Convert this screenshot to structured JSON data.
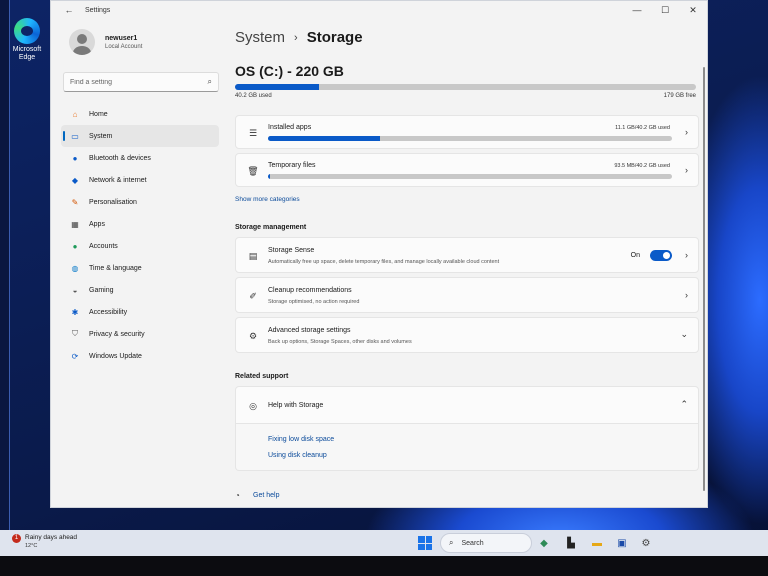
{
  "window": {
    "title": "Settings",
    "controls": {
      "minimize": "—",
      "maximize": "☐",
      "close": "✕"
    }
  },
  "desktop": {
    "edge_label": "Microsoft Edge"
  },
  "profile": {
    "name": "newuser1",
    "account_type": "Local Account"
  },
  "search": {
    "placeholder": "Find a setting"
  },
  "nav": [
    {
      "label": "Home",
      "icon": "home-icon",
      "color": "#e8792b",
      "active": false
    },
    {
      "label": "System",
      "icon": "system-icon",
      "color": "#0a5ac8",
      "active": true
    },
    {
      "label": "Bluetooth & devices",
      "icon": "bluetooth-icon",
      "color": "#0a5ac8",
      "active": false
    },
    {
      "label": "Network & internet",
      "icon": "wifi-icon",
      "color": "#0a5ac8",
      "active": false
    },
    {
      "label": "Personalisation",
      "icon": "brush-icon",
      "color": "#d35400",
      "active": false
    },
    {
      "label": "Apps",
      "icon": "apps-icon",
      "color": "#444444",
      "active": false
    },
    {
      "label": "Accounts",
      "icon": "person-icon",
      "color": "#1e9a5a",
      "active": false
    },
    {
      "label": "Time & language",
      "icon": "globe-clock-icon",
      "color": "#0a7ac8",
      "active": false
    },
    {
      "label": "Gaming",
      "icon": "gamepad-icon",
      "color": "#555555",
      "active": false
    },
    {
      "label": "Accessibility",
      "icon": "accessibility-icon",
      "color": "#0a5ac8",
      "active": false
    },
    {
      "label": "Privacy & security",
      "icon": "shield-icon",
      "color": "#555555",
      "active": false
    },
    {
      "label": "Windows Update",
      "icon": "update-icon",
      "color": "#0a5ac8",
      "active": false
    }
  ],
  "breadcrumb": {
    "parent": "System",
    "separator": "›",
    "current": "Storage"
  },
  "drive": {
    "title": "OS (C:) - 220 GB",
    "used_label": "40.2 GB used",
    "free_label": "179 GB free",
    "used_fraction": 0.183
  },
  "categories": [
    {
      "title": "Installed apps",
      "value": "11.1 GB/40.2 GB used",
      "fraction": 0.276,
      "icon": "list-icon"
    },
    {
      "title": "Temporary files",
      "value": "93.5 MB/40.2 GB used",
      "fraction": 0.005,
      "icon": "trash-icon"
    }
  ],
  "show_more": "Show more categories",
  "management": {
    "heading": "Storage management",
    "storage_sense": {
      "title": "Storage Sense",
      "desc": "Automatically free up space, delete temporary files, and manage locally available cloud content",
      "toggle_label": "On",
      "on": true
    },
    "cleanup": {
      "title": "Cleanup recommendations",
      "desc": "Storage optimised, no action required"
    },
    "advanced": {
      "title": "Advanced storage settings",
      "desc": "Back up options, Storage Spaces, other disks and volumes"
    }
  },
  "support": {
    "heading": "Related support",
    "title": "Help with Storage",
    "links": [
      "Fixing low disk space",
      "Using disk cleanup"
    ]
  },
  "get_help": "Get help",
  "taskbar": {
    "weather_title": "Rainy days ahead",
    "weather_temp": "12°C",
    "weather_badge": "1",
    "search_label": "Search"
  }
}
